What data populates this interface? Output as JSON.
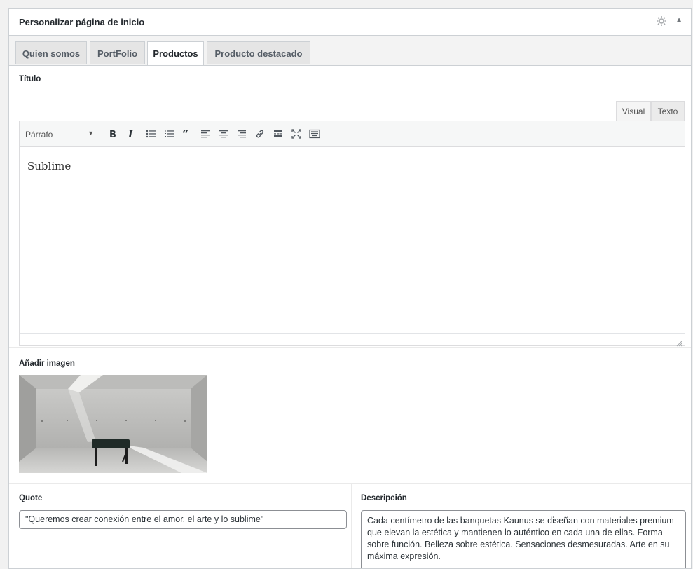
{
  "metabox": {
    "title": "Personalizar página de inicio",
    "gear_icon": "gear-icon",
    "toggle_icon": "triangle-up-icon",
    "toggle_glyph": "▲"
  },
  "tabs": [
    {
      "label": "Quien somos",
      "active": false
    },
    {
      "label": "PortFolio",
      "active": false
    },
    {
      "label": "Productos",
      "active": true
    },
    {
      "label": "Producto destacado",
      "active": false
    }
  ],
  "titulo": {
    "label": "Título",
    "editor_tabs": {
      "visual": "Visual",
      "texto": "Texto"
    },
    "format_select": "Párrafo",
    "toolbar_icons": [
      "bold-icon",
      "italic-icon",
      "bullet-list-icon",
      "numbered-list-icon",
      "blockquote-icon",
      "align-left-icon",
      "align-center-icon",
      "align-right-icon",
      "link-icon",
      "read-more-icon",
      "fullscreen-icon",
      "toolbar-toggle-icon"
    ],
    "content": "Sublime"
  },
  "imagen": {
    "label": "Añadir imagen"
  },
  "quote": {
    "label": "Quote",
    "value": "\"Queremos crear conexión entre el amor, el arte y lo sublime\""
  },
  "descripcion": {
    "label": "Descripción",
    "value": "Cada centímetro de las banquetas Kaunus se diseñan con materiales premium que elevan la estética y mantienen lo auténtico en cada una de ellas. Forma sobre función. Belleza sobre estética. Sensaciones desmesuradas. Arte en su máxima expresión."
  },
  "colors": {
    "border": "#ccd0d4",
    "tab_inactive": "#e5e5e5",
    "text": "#23282d"
  }
}
